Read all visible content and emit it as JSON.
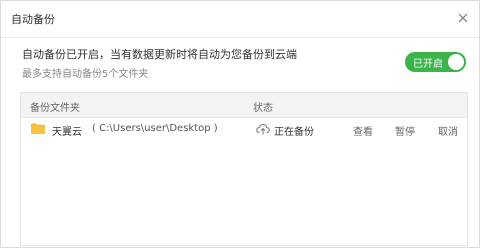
{
  "dialog": {
    "title": "自动备份",
    "close_icon": "close-icon"
  },
  "info": {
    "status_text": "自动备份已开启，当有数据更新时将自动为您备份到云端",
    "limit_text": "最多支持自动备份5个文件夹"
  },
  "toggle": {
    "label": "已开启",
    "state": "on",
    "color": "#3cb44b"
  },
  "table": {
    "columns": {
      "folder": "备份文件夹",
      "status": "状态"
    },
    "rows": [
      {
        "icon": "folder-icon",
        "name": "天翼云",
        "path": "( C:\\Users\\user\\Desktop )",
        "status_icon": "cloud-upload-icon",
        "status": "正在备份",
        "actions": {
          "view": "查看",
          "pause": "暂停",
          "cancel": "取消"
        }
      }
    ]
  }
}
